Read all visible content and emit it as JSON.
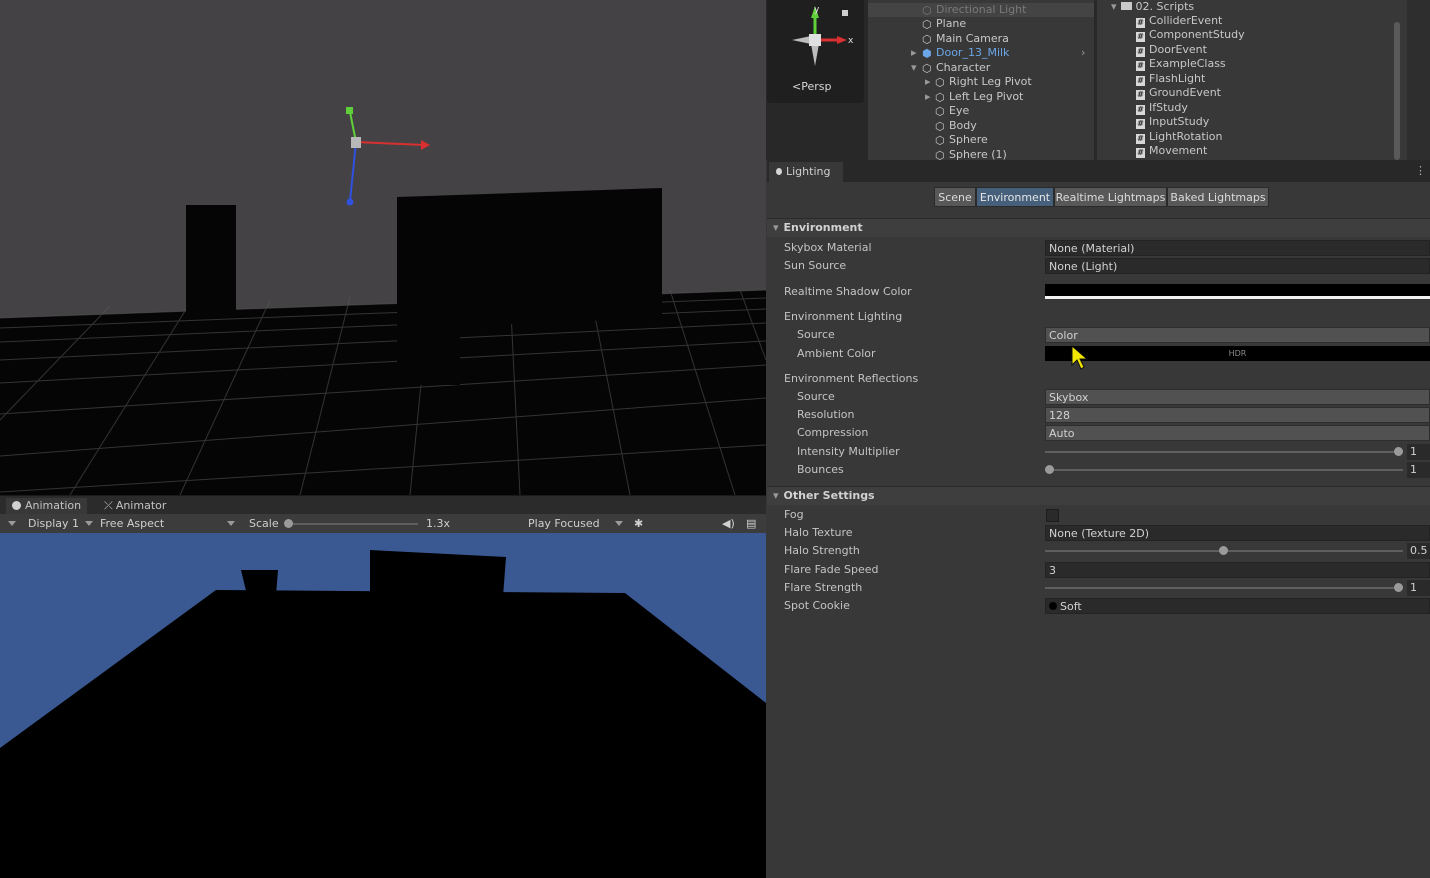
{
  "scene": {
    "persp_label": "Persp",
    "gizmo_axes": {
      "y": "y",
      "x": "x"
    }
  },
  "game": {
    "tabs": [
      {
        "label": "Animation",
        "icon": "clock-icon"
      },
      {
        "label": "Animator",
        "icon": "animator-icon"
      }
    ],
    "display": "Display 1",
    "aspect": "Free Aspect",
    "scale_label": "Scale",
    "scale_value": "1.3x",
    "play_mode": "Play Focused",
    "sky_color": "#3a5892"
  },
  "hierarchy": {
    "items": [
      {
        "label": "Directional Light",
        "indent": 0,
        "dimmed": true
      },
      {
        "label": "Plane",
        "indent": 0
      },
      {
        "label": "Main Camera",
        "indent": 0
      },
      {
        "label": "Door_13_Milk",
        "indent": 0,
        "prefab": true,
        "expandable": true
      },
      {
        "label": "Character",
        "indent": 0,
        "expanded": true
      },
      {
        "label": "Right Leg Pivot",
        "indent": 1,
        "expandable": true
      },
      {
        "label": "Left Leg Pivot",
        "indent": 1,
        "expandable": true
      },
      {
        "label": "Eye",
        "indent": 1
      },
      {
        "label": "Body",
        "indent": 1
      },
      {
        "label": "Sphere",
        "indent": 1
      },
      {
        "label": "Sphere (1)",
        "indent": 1
      }
    ]
  },
  "project": {
    "folder": "02. Scripts",
    "scripts": [
      "ColliderEvent",
      "ComponentStudy",
      "DoorEvent",
      "ExampleClass",
      "FlashLight",
      "GroundEvent",
      "IfStudy",
      "InputStudy",
      "LightRotation",
      "Movement"
    ]
  },
  "lighting": {
    "tab_title": "Lighting",
    "tabs": [
      "Scene",
      "Environment",
      "Realtime Lightmaps",
      "Baked Lightmaps"
    ],
    "active_tab": "Environment",
    "environment": {
      "header": "Environment",
      "skybox_material_label": "Skybox Material",
      "skybox_material_value": "None (Material)",
      "sun_source_label": "Sun Source",
      "sun_source_value": "None (Light)",
      "realtime_shadow_color_label": "Realtime Shadow Color",
      "environment_lighting_label": "Environment Lighting",
      "source_label": "Source",
      "source_value": "Color",
      "ambient_color_label": "Ambient Color",
      "ambient_hdr": "HDR",
      "env_reflections_label": "Environment Reflections",
      "refl_source_label": "Source",
      "refl_source_value": "Skybox",
      "resolution_label": "Resolution",
      "resolution_value": "128",
      "compression_label": "Compression",
      "compression_value": "Auto",
      "intensity_label": "Intensity Multiplier",
      "intensity_value": "1",
      "bounces_label": "Bounces",
      "bounces_value": "1"
    },
    "other": {
      "header": "Other Settings",
      "fog_label": "Fog",
      "fog_enabled": false,
      "halo_texture_label": "Halo Texture",
      "halo_texture_value": "None (Texture 2D)",
      "halo_strength_label": "Halo Strength",
      "halo_strength_value": "0.5",
      "flare_fade_label": "Flare Fade Speed",
      "flare_fade_value": "3",
      "flare_strength_label": "Flare Strength",
      "flare_strength_value": "1",
      "spot_cookie_label": "Spot Cookie",
      "spot_cookie_value": "Soft"
    }
  }
}
